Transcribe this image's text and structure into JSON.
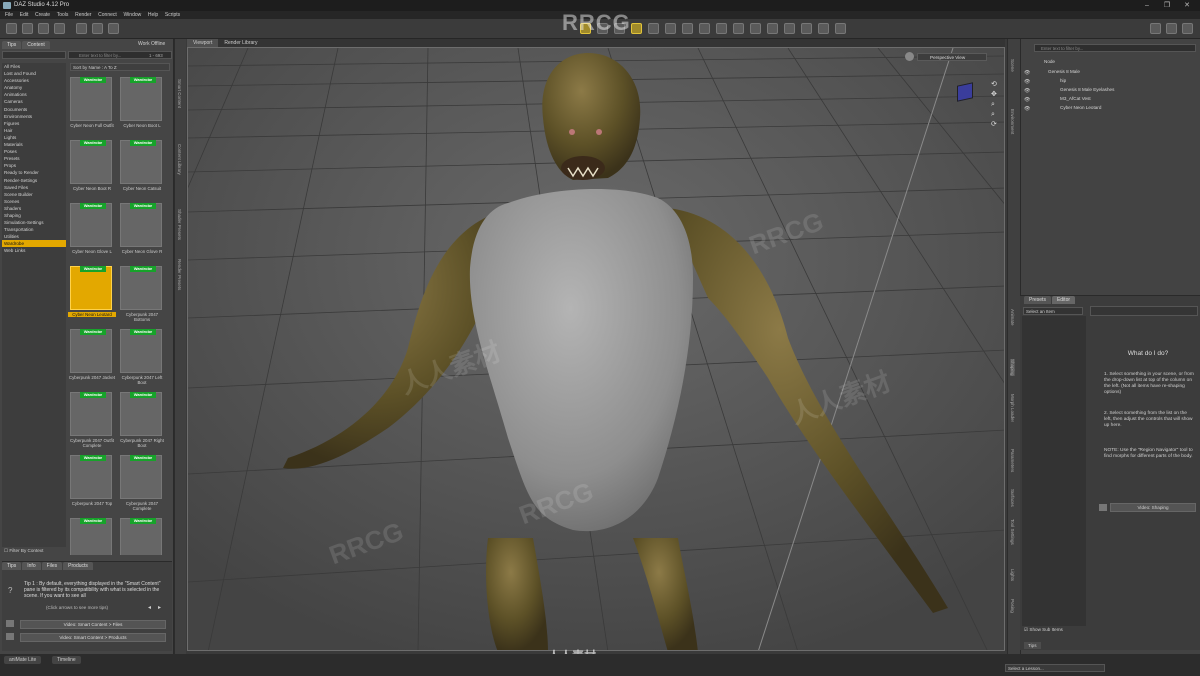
{
  "app": {
    "title": "DAZ Studio 4.12 Pro",
    "window_controls": [
      "–",
      "❐",
      "✕"
    ]
  },
  "watermark": {
    "top": "RRCG",
    "center": "人人素材",
    "repeat": [
      "RRCG",
      "人人素材"
    ]
  },
  "menu": [
    "File",
    "Edit",
    "Create",
    "Tools",
    "Render",
    "Connect",
    "Window",
    "Help",
    "Scripts"
  ],
  "left": {
    "tabs": [
      "Tips",
      "Content",
      "Smart Content"
    ],
    "work_offline": "Work Offline",
    "filter_placeholder": "Enter text to filter by...",
    "filter_count": "1 - 693",
    "sort_label": "Sort by Name : A To Z",
    "categories": [
      "All Files",
      "Lost and Found",
      "Accessories",
      "Anatomy",
      "Animations",
      "Cameras",
      "Documents",
      "Environments",
      "Figures",
      "Hair",
      "Lights",
      "Materials",
      "Poses",
      "Presets",
      "Props",
      "Ready to Render",
      "Render-Settings",
      "Saved Files",
      "Scene Builder",
      "Scenes",
      "Shaders",
      "Shaping",
      "Simulation-Settings",
      "Transportation",
      "Utilities",
      "Wardrobe",
      "Web Links"
    ],
    "selected_category": "Wardrobe",
    "filter_by_context": "Filter By Context",
    "items": [
      {
        "label": "Cyber Neon Full Outfit",
        "badge": "Wardrobe"
      },
      {
        "label": "Cyber Neon Boot L",
        "badge": "Wardrobe"
      },
      {
        "label": "Cyber Neon Boot R",
        "badge": "Wardrobe"
      },
      {
        "label": "Cyber Neon Catsuit",
        "badge": "Wardrobe"
      },
      {
        "label": "Cyber Neon Glove L",
        "badge": "Wardrobe"
      },
      {
        "label": "Cyber Neon Glove R",
        "badge": "Wardrobe"
      },
      {
        "label": "Cyber Neon Leotard",
        "badge": "Wardrobe",
        "selected": true
      },
      {
        "label": "Cyberpunk 2047 Bottoms",
        "badge": "Wardrobe"
      },
      {
        "label": "Cyberpunk 2047 Jacket",
        "badge": "Wardrobe"
      },
      {
        "label": "Cyberpunk 2047 Left Boot",
        "badge": "Wardrobe"
      },
      {
        "label": "Cyberpunk 2047 Outfit Complete",
        "badge": "Wardrobe"
      },
      {
        "label": "Cyberpunk 2047 Right Boot",
        "badge": "Wardrobe"
      },
      {
        "label": "Cyberpunk 2047 Top",
        "badge": "Wardrobe"
      },
      {
        "label": "Cyberpunk 2047 Complete",
        "badge": "Wardrobe"
      },
      {
        "label": "",
        "badge": "Wardrobe"
      },
      {
        "label": "",
        "badge": "Wardrobe"
      }
    ],
    "tips_tabs": [
      "Tips",
      "Info",
      "Files",
      "Products"
    ],
    "tip_text": "Tip 1 : By default, everything displayed in the \"Smart Content\" pane is filtered by its compatibility with what is selected in the scene. If you want to see all",
    "tip_more": "(Click arrows to see more tips)",
    "video1": "Video: Smart Content > Files",
    "video2": "Video: Smart Content > Products"
  },
  "left_strip_labels": [
    "Smart Content",
    "Content Library",
    "Shader Presets",
    "Render Presets"
  ],
  "viewport": {
    "tabs": [
      "Viewport",
      "Render Library"
    ],
    "camera": "Perspective View"
  },
  "right_strip_labels": [
    "Scene",
    "Environment",
    "Animate",
    "Shaping",
    "Morph Loader",
    "Parameters",
    "Surfaces",
    "Tool Settings",
    "Lights",
    "Posing"
  ],
  "scene": {
    "search_placeholder": "Enter text to filter by...",
    "header": "Node",
    "rows": [
      {
        "label": "Genesis 8 Male",
        "indent": 0
      },
      {
        "label": "hip",
        "indent": 1
      },
      {
        "label": "Genesis 8 Male Eyelashes",
        "indent": 1
      },
      {
        "label": "M3_AfCat Vest",
        "indent": 1
      },
      {
        "label": "Cyber Neon Leotard",
        "indent": 1
      }
    ]
  },
  "editor": {
    "tabs": [
      "Presets",
      "Editor"
    ],
    "select_item": "Select an Item",
    "heading": "What do I do?",
    "steps": [
      "1. Select something in your scene, or from the drop-down list at top of the column on the left. (Not all items have re-shaping options)",
      "2. Select something from the list on the left, then adjust the controls that will show up here.",
      "NOTE: Use the \"Region Navigator\" tool to find morphs for different parts of the body."
    ],
    "video": "Video: Shaping",
    "show_subitems": "Show Sub Items",
    "tips": "Tips"
  },
  "bottom": {
    "tab1": "aniMate Lite",
    "tab2": "Timeline",
    "lesson": "Select a Lesson..."
  }
}
